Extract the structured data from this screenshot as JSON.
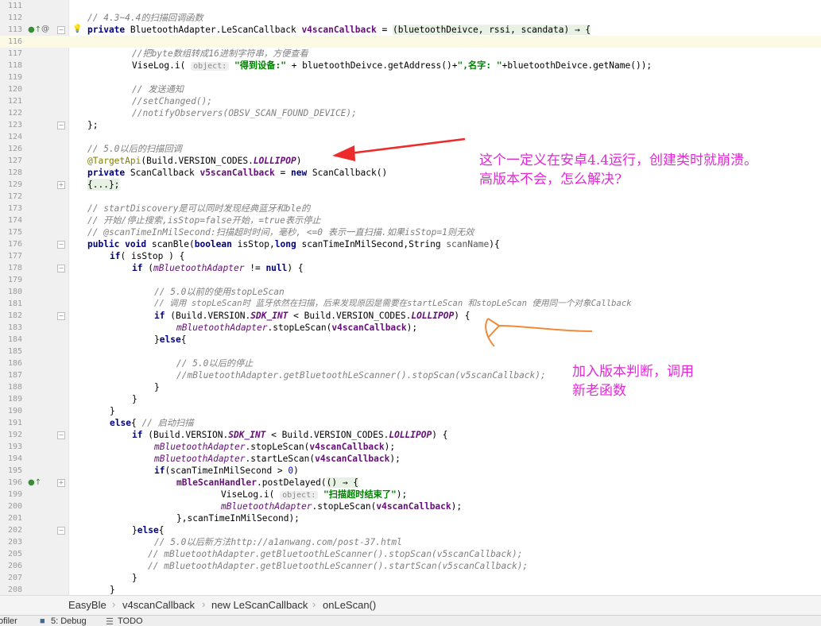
{
  "editor": {
    "lines": [
      {
        "n": "111",
        "t": ""
      },
      {
        "n": "113",
        "t": "// 4.3~4.4的扫描回调函数"
      },
      {
        "n": "116",
        "t": ""
      },
      {
        "n": "117",
        "t": "//把byte数组转成16进制字符串，方便查看"
      },
      {
        "n": "118",
        "t": "ViseLog.i( object: \"得到设备:\" + bluetoothDeivce.getAddress()+\",名字: \"+bluetoothDeivce.getName());"
      },
      {
        "n": "119",
        "t": ""
      },
      {
        "n": "120",
        "t": "// 发送通知"
      },
      {
        "n": "121",
        "t": "//setChanged();"
      },
      {
        "n": "122",
        "t": "//notifyObservers(OBSV_SCAN_FOUND_DEVICE);"
      },
      {
        "n": "123",
        "t": "};"
      },
      {
        "n": "124",
        "t": ""
      },
      {
        "n": "126",
        "t": "// 5.0以后的扫描回调"
      },
      {
        "n": "127",
        "t": "@TargetApi(Build.VERSION_CODES.LOLLIPOP)"
      },
      {
        "n": "128",
        "t": "private ScanCallback v5scanCallback = new ScanCallback()"
      },
      {
        "n": "129",
        "t": "{...};"
      },
      {
        "n": "172",
        "t": ""
      },
      {
        "n": "173",
        "t": "// startDiscovery是可以同时发现经典蓝牙和ble的"
      },
      {
        "n": "174",
        "t": "// 开始/停止搜索,isStop=false开始，=true表示停止"
      },
      {
        "n": "175",
        "t": "// @scanTimeInMilSecond:扫描超时时间，毫秒, <=0 表示一直扫描.如果isStop=1则无效"
      },
      {
        "n": "176",
        "t": "public void scanBle(boolean isStop,long scanTimeInMilSecond,String scanName){"
      },
      {
        "n": "177",
        "t": "if( isStop ) {"
      },
      {
        "n": "178",
        "t": "if (mBluetoothAdapter != null) {"
      },
      {
        "n": "179",
        "t": ""
      },
      {
        "n": "180",
        "t": "// 5.0以前的使用stopLeScan"
      },
      {
        "n": "181",
        "t": "// 调用 stopLeScan时 蓝牙依然在扫描，后来发现原因是需要在startLeScan 和stopLeScan 使用同一个对象Callback"
      },
      {
        "n": "182",
        "t": "if (Build.VERSION.SDK_INT < Build.VERSION_CODES.LOLLIPOP) {"
      },
      {
        "n": "183",
        "t": "mBluetoothAdapter.stopLeScan(v4scanCallback);"
      },
      {
        "n": "184",
        "t": "}else{"
      },
      {
        "n": "185",
        "t": ""
      },
      {
        "n": "186",
        "t": "// 5.0以后的停止"
      },
      {
        "n": "187",
        "t": "//mBluetoothAdapter.getBluetoothLeScanner().stopScan(v5scanCallback);"
      },
      {
        "n": "188",
        "t": "}"
      },
      {
        "n": "189",
        "t": "}"
      },
      {
        "n": "190",
        "t": "}"
      },
      {
        "n": "191",
        "t": "else{ // 启动扫描"
      },
      {
        "n": "192",
        "t": "if (Build.VERSION.SDK_INT < Build.VERSION_CODES.LOLLIPOP) {"
      },
      {
        "n": "193",
        "t": "mBluetoothAdapter.stopLeScan(v4scanCallback);"
      },
      {
        "n": "194",
        "t": "mBluetoothAdapter.startLeScan(v4scanCallback);"
      },
      {
        "n": "195",
        "t": "if(scanTimeInMilSecond > 0)"
      },
      {
        "n": "196",
        "t": "mBleScanHandler.postDelayed(() → {"
      },
      {
        "n": "199",
        "t": "ViseLog.i( object: \"扫描超时结束了\");"
      },
      {
        "n": "200",
        "t": "mBluetoothAdapter.stopLeScan(v4scanCallback);"
      },
      {
        "n": "201",
        "t": "},scanTimeInMilSecond);"
      },
      {
        "n": "202",
        "t": "}else{"
      },
      {
        "n": "203",
        "t": "// 5.0以后新方法http://a1anwang.com/post-37.html"
      },
      {
        "n": "205",
        "t": "// mBluetoothAdapter.getBluetoothLeScanner().stopScan(v5scanCallback);"
      },
      {
        "n": "206",
        "t": "// mBluetoothAdapter.getBluetoothLeScanner().startScan(v5scanCallback);"
      },
      {
        "n": "207",
        "t": "}"
      },
      {
        "n": "208",
        "t": "}"
      }
    ],
    "line113": {
      "t": "private BluetoothAdapter.LeScanCallback v4scanCallback = (bluetoothDeivce, rssi, scandata) → {"
    }
  },
  "annotations": {
    "note1_line1": "这个一定义在安卓4.4运行，创建类时就崩溃。",
    "note1_line2": "高版本不会，怎么解决?",
    "note2_line1": "加入版本判断，调用",
    "note2_line2": "新老函数",
    "arrow1_color": "#ee2b2b",
    "arrow2_color": "#f08a3a"
  },
  "breadcrumb": {
    "items": [
      "EasyBle",
      "v4scanCallback",
      "new LeScanCallback",
      "onLeScan()"
    ]
  },
  "toolbar": {
    "items": [
      "ofiler",
      "5: Debug",
      "TODO"
    ]
  }
}
